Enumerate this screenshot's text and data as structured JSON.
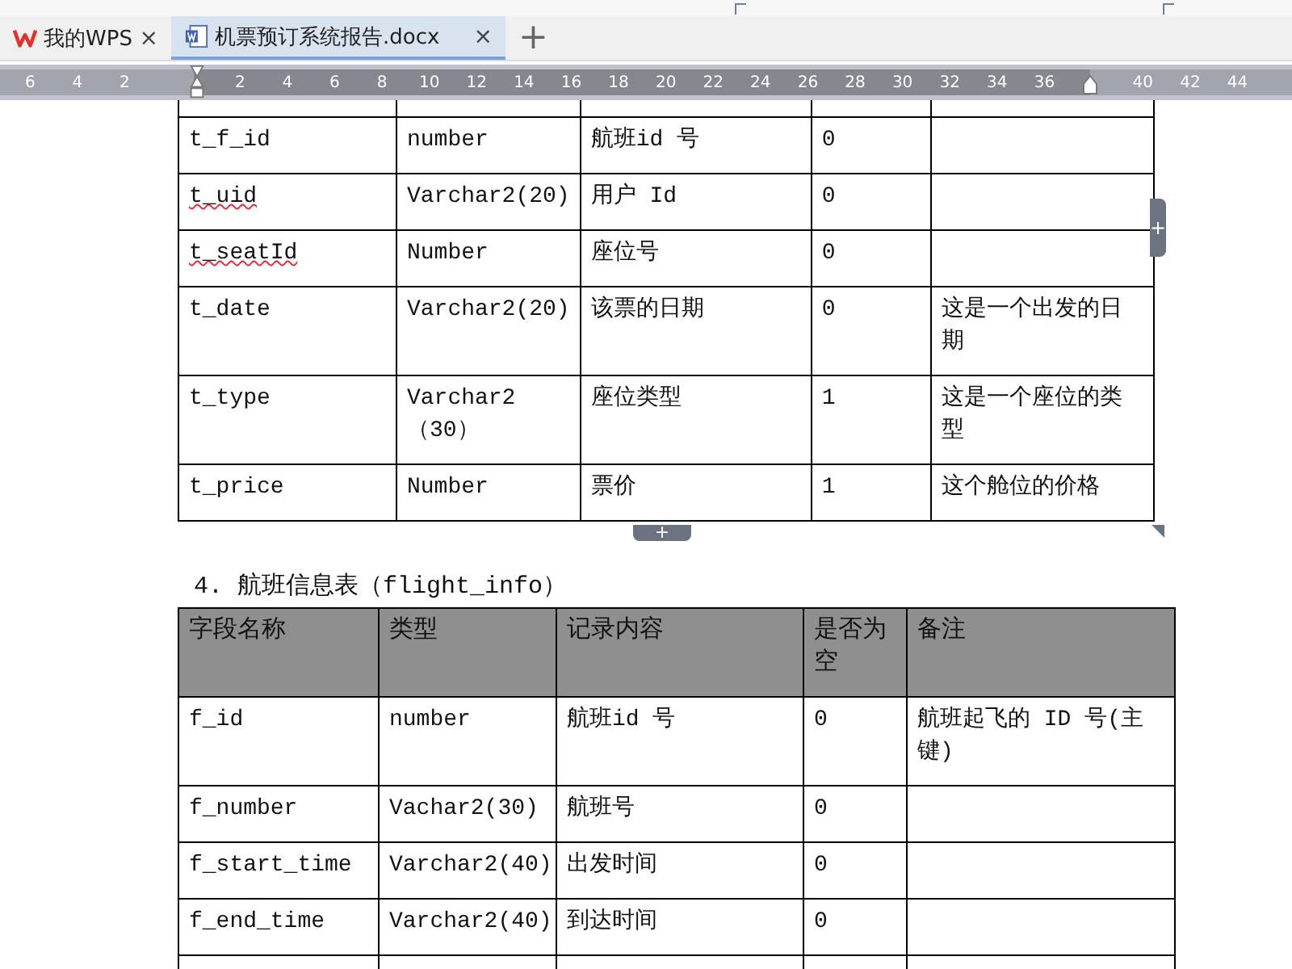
{
  "tabs": [
    {
      "label": "我的WPS",
      "kind": "home",
      "selected": false,
      "close": "×"
    },
    {
      "label": "机票预订系统报告.docx",
      "kind": "doc",
      "selected": true,
      "close": "×"
    }
  ],
  "new_tab": "+",
  "ruler": {
    "left_numbers": [
      "6",
      "4",
      "2"
    ],
    "numbers": [
      "2",
      "4",
      "6",
      "8",
      "10",
      "12",
      "14",
      "16",
      "18",
      "20",
      "22",
      "24",
      "26",
      "28",
      "30",
      "32",
      "34",
      "36"
    ],
    "right_numbers": [
      "40",
      "42",
      "44"
    ]
  },
  "table_1": {
    "add_column": "+",
    "add_row": "+",
    "rows": [
      {
        "cells": [
          "t_f_id",
          "number",
          "航班id 号",
          "0",
          ""
        ],
        "flagged": false
      },
      {
        "cells": [
          "t_uid",
          "Varchar2(20)",
          "用户 Id",
          "0",
          ""
        ],
        "flagged": true
      },
      {
        "cells": [
          "t_seatId",
          "Number",
          "座位号",
          "0",
          ""
        ],
        "flagged": true
      },
      {
        "cells": [
          "t_date",
          "Varchar2(20)",
          "该票的日期",
          "0",
          "这是一个出发的日期"
        ],
        "flagged": false
      },
      {
        "cells": [
          "t_type",
          "Varchar2（30）",
          "座位类型",
          "1",
          "这是一个座位的类型"
        ],
        "flagged": false
      },
      {
        "cells": [
          "t_price",
          "Number",
          "票价",
          "1",
          "这个舱位的价格"
        ],
        "flagged": false
      }
    ]
  },
  "heading": "4. 航班信息表（flight_info）",
  "table_2": {
    "columns": [
      "字段名称",
      "类型",
      "记录内容",
      "是否为空",
      "备注"
    ],
    "rows": [
      {
        "cells": [
          "f_id",
          "number",
          "航班id 号",
          "0",
          "航班起飞的 ID 号(主键)"
        ]
      },
      {
        "cells": [
          "f_number",
          "Vachar2(30)",
          "航班号",
          "0",
          ""
        ]
      },
      {
        "cells": [
          "f_start_time",
          "Varchar2(40)",
          "出发时间",
          "0",
          ""
        ]
      },
      {
        "cells": [
          "f_end_time",
          "Varchar2(40)",
          "到达时间",
          "0",
          ""
        ]
      }
    ]
  }
}
